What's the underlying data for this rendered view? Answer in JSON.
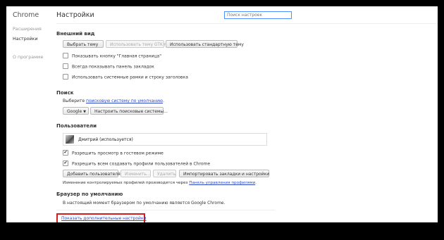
{
  "sidebar": {
    "brand": "Chrome",
    "items": [
      {
        "label": "Расширения"
      },
      {
        "label": "Настройки"
      },
      {
        "label": "О программе"
      }
    ]
  },
  "header": {
    "title": "Настройки",
    "search_placeholder": "Поиск настроек"
  },
  "appearance": {
    "heading": "Внешний вид",
    "buttons": [
      "Выбрать тему",
      "Использовать тему GTK+",
      "Использовать стандартную тему"
    ],
    "checkboxes": [
      {
        "label": "Показывать кнопку \"Главная страница\"",
        "checked": false
      },
      {
        "label": "Всегда показывать панель закладок",
        "checked": false
      },
      {
        "label": "Использовать системные рамки и строку заголовка",
        "checked": false
      }
    ]
  },
  "search": {
    "heading": "Поиск",
    "prefix": "Выберите ",
    "link": "поисковую систему по умолчанию",
    "suffix": ".",
    "engine": "Google",
    "manage_button": "Настроить поисковые системы..."
  },
  "users": {
    "heading": "Пользователи",
    "current_user": "Дмитрий (используется)",
    "checkboxes": [
      {
        "label": "Разрешить просмотр в гостевом режиме",
        "checked": true
      },
      {
        "label": "Разрешить всем создавать профили пользователей в Chrome",
        "checked": true
      }
    ],
    "buttons": [
      "Добавить пользователя",
      "Изменить...",
      "Удалить",
      "Импортировать закладки и настройки"
    ],
    "note_prefix": "Изменение контролируемых профилей производится через ",
    "note_link": "Панель управления профилями",
    "note_suffix": "."
  },
  "default_browser": {
    "heading": "Браузер по умолчанию",
    "text": "В настоящий момент браузером по умолчанию является Google Chrome."
  },
  "advanced": {
    "link": "Показать дополнительные настройки"
  },
  "check_mark": "✔",
  "dropdown_arrow": "▼"
}
